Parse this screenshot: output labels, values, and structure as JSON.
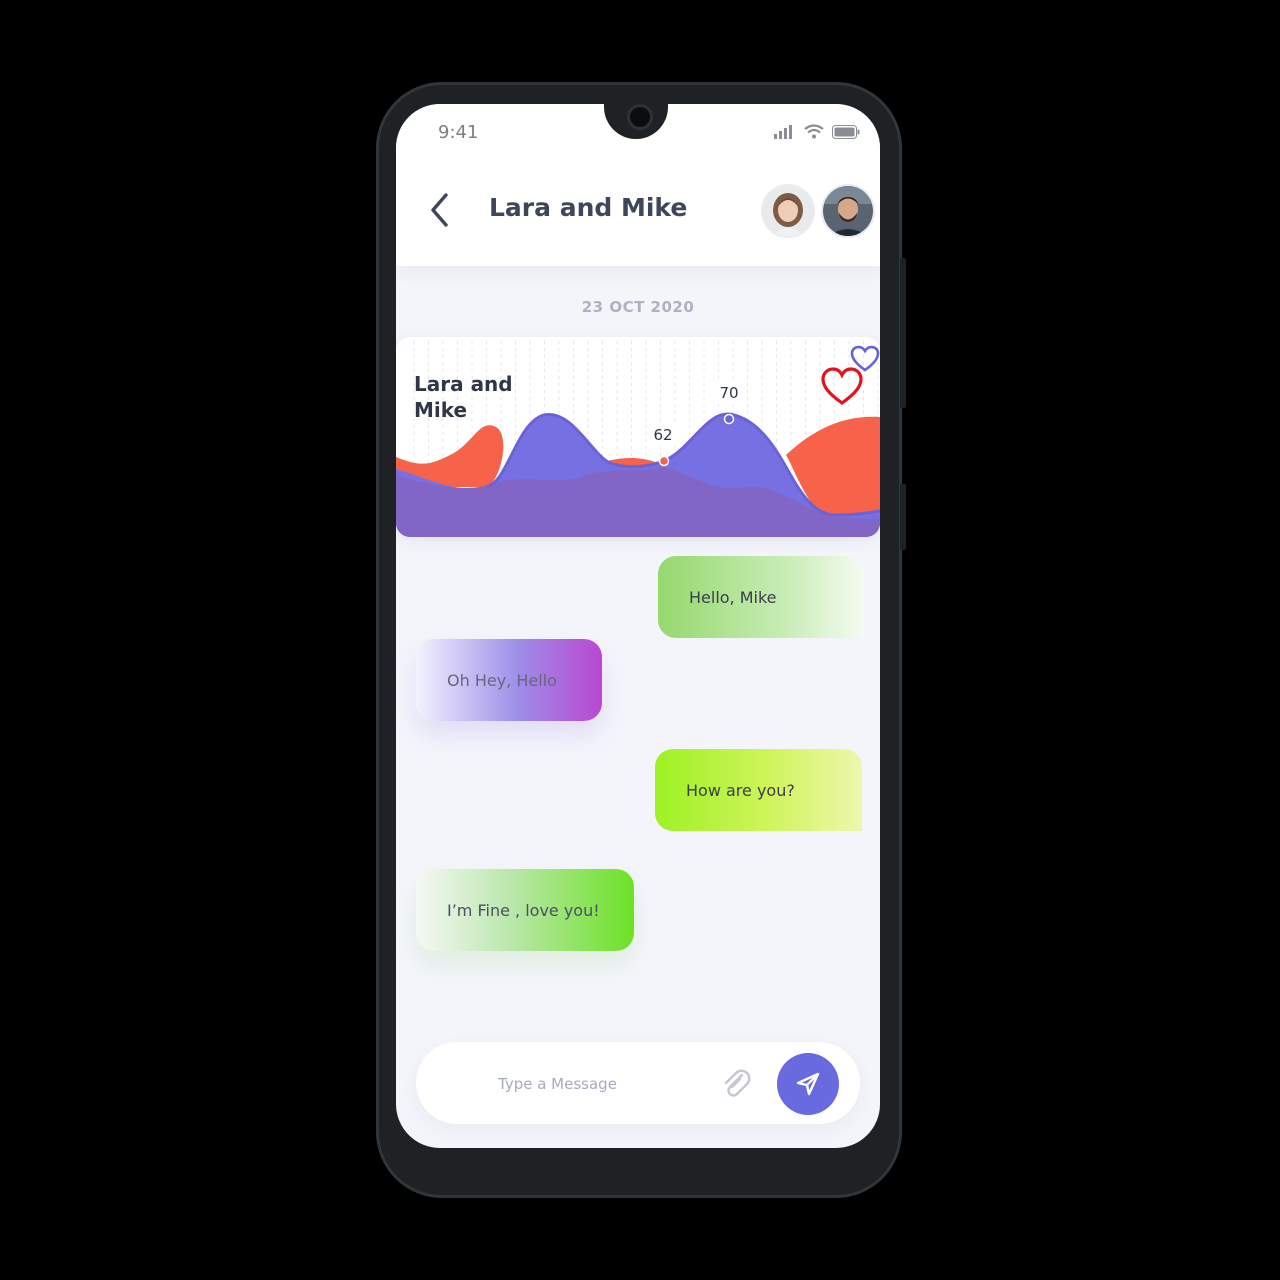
{
  "status": {
    "time": "9:41"
  },
  "header": {
    "title": "Lara and Mike"
  },
  "date": "23 OCT 2020",
  "chart_data": {
    "type": "area",
    "title": "Lara and Mike",
    "series": [
      {
        "color": "#f7624a"
      },
      {
        "color": "#7066e0"
      }
    ],
    "annotations": [
      {
        "label": "62",
        "color": "#f7624a"
      },
      {
        "label": "70",
        "color": "#6a63d8"
      }
    ]
  },
  "messages": [
    {
      "text": "Hello, Mike",
      "from": "self"
    },
    {
      "text": "Oh Hey, Hello",
      "from": "other"
    },
    {
      "text": "How are you?",
      "from": "self"
    },
    {
      "text": "I’m Fine , love you!",
      "from": "other"
    }
  ],
  "composer": {
    "placeholder": "Type a Message"
  },
  "colors": {
    "accent": "#6a6ae0",
    "title": "#3d4759",
    "heart_red": "#e4121c",
    "heart_blue": "#6262df"
  }
}
